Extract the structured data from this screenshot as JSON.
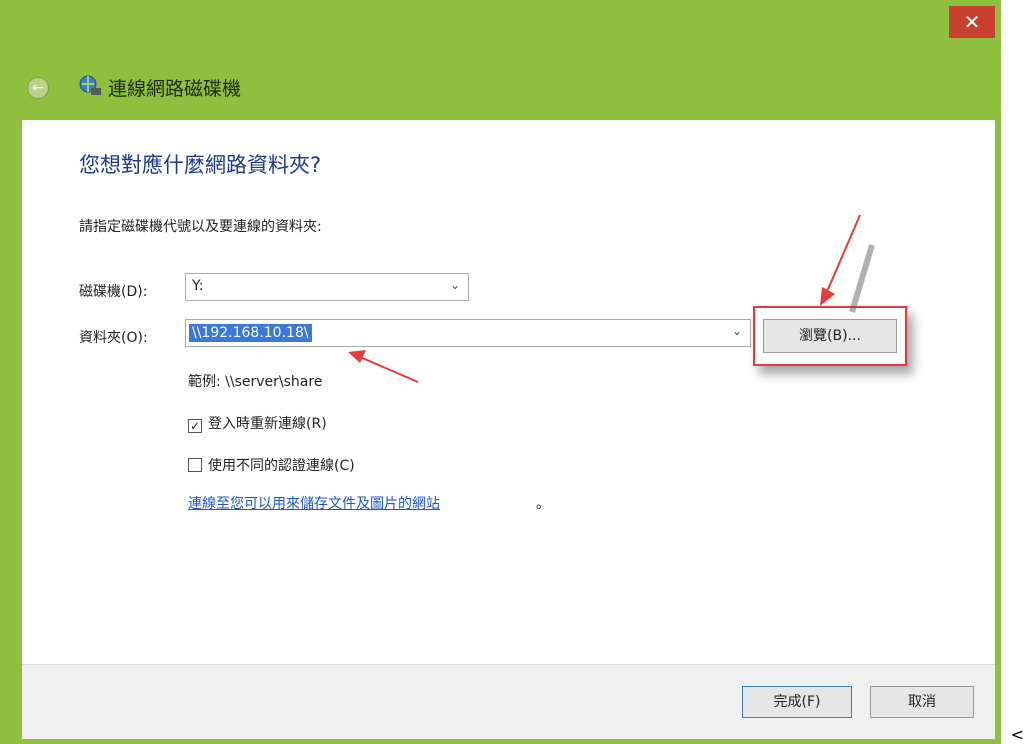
{
  "window": {
    "title": "連線網路磁碟機",
    "close_label": "✕",
    "back_label": "←"
  },
  "content": {
    "heading": "您想對應什麼網路資料夾?",
    "instruction": "請指定磁碟機代號以及要連線的資料夾:",
    "drive_label": "磁碟機(D):",
    "drive_value": "Y:",
    "folder_label": "資料夾(O):",
    "folder_value": "\\\\192.168.10.18\\",
    "browse_label": "瀏覽(B)...",
    "example": "範例: \\\\server\\share",
    "reconnect_label": "登入時重新連線(R)",
    "reconnect_checked": true,
    "credentials_label": "使用不同的認證連線(C)",
    "credentials_checked": false,
    "link_text": "連線至您可以用來儲存文件及圖片的網站",
    "link_suffix": "。"
  },
  "footer": {
    "finish_label": "完成(F)",
    "cancel_label": "取消"
  },
  "trailing_text": "<",
  "colors": {
    "accent_green": "#8fbf3e",
    "close_red": "#c7402e",
    "annotation_red": "#e83a3a",
    "heading_blue": "#1d3a8a",
    "link_blue": "#1d57c9",
    "selection_blue": "#3b78d8"
  }
}
